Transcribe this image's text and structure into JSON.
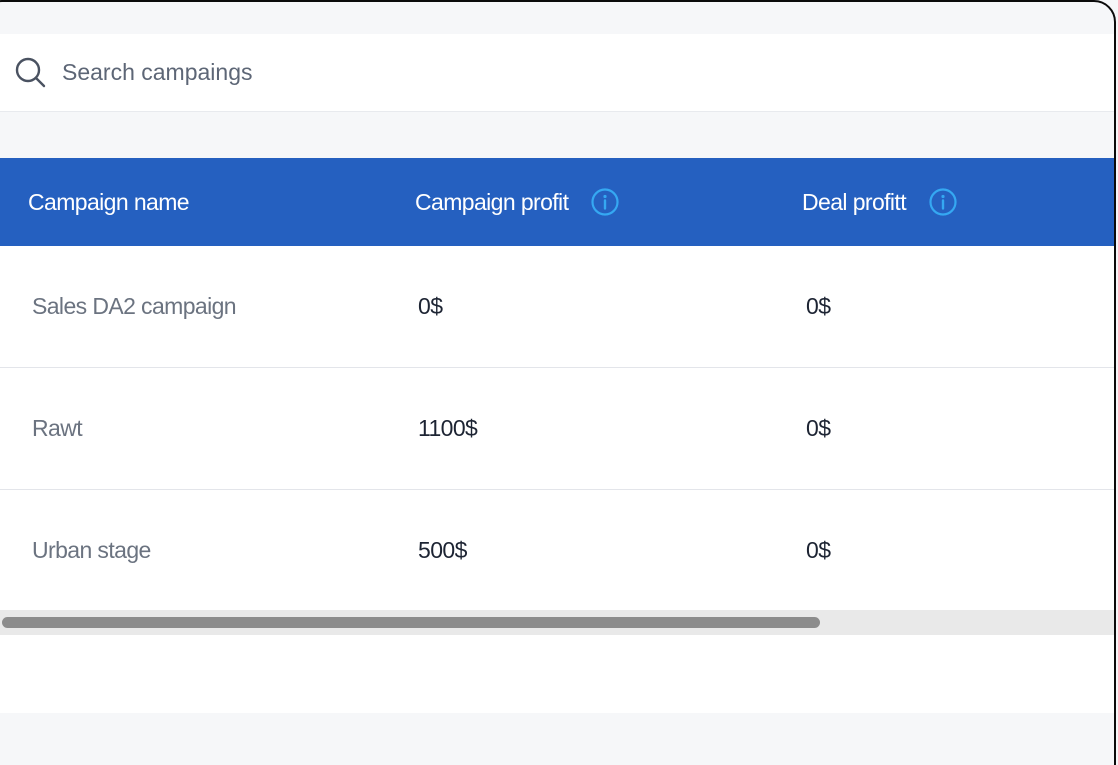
{
  "search": {
    "placeholder": "Search campaings",
    "icon": "search-icon"
  },
  "table": {
    "columns": [
      {
        "label": "Campaign name",
        "info_icon": false
      },
      {
        "label": "Campaign profit",
        "info_icon": true
      },
      {
        "label": "Deal profitt",
        "info_icon": true
      }
    ],
    "rows": [
      {
        "name": "Sales DA2 campaign",
        "campaign_profit": "0$",
        "deal_profit": "0$"
      },
      {
        "name": "Rawt",
        "campaign_profit": "1100$",
        "deal_profit": "0$"
      },
      {
        "name": "Urban stage",
        "campaign_profit": "500$",
        "deal_profit": "0$"
      }
    ]
  },
  "colors": {
    "header_bg": "#2560c0",
    "info_icon": "#35a8f2",
    "page_bg": "#f6f7f9",
    "scrollbar_thumb": "#8c8c8c"
  },
  "scrollbar": {
    "visible_fraction": 0.73
  }
}
